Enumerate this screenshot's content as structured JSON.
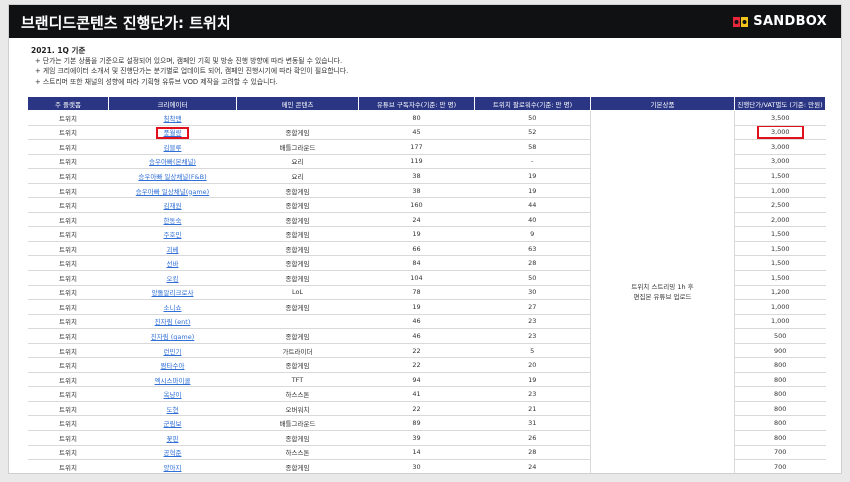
{
  "header": {
    "title": "브랜디드콘텐츠 진행단가: 트위치",
    "brand": "SANDBOX",
    "brand_color": "#e8263c"
  },
  "subtitle": "2021. 1Q 기준",
  "notes": [
    "+ 단가는 기본 상품을 기준으로 설정되어 있으며, 캠페인 기획 및 방송 진행 방향에 따라 변동될 수 있습니다.",
    "+ 게임 크리에이터 소개서 및 진행단가는 분기별로 업데이트 되어, 캠페인 진행시기에 따라 확인이 필요합니다.",
    "+ 스트리머 또한 채널의 성향에 따라 기획형 유튜브 VOD 제작을 고려할 수 있습니다."
  ],
  "table": {
    "headers": [
      "주 플랫폼",
      "크리에이터",
      "메인 콘텐츠",
      "유튜브 구독자수(기준: 만 명)",
      "트위치 팔로워수(기준: 만 명)",
      "기본상품",
      "진행단가/VAT별도 (기준: 만원)"
    ],
    "basic_product_lines": [
      "트위치 스트리밍 1h 후",
      "편집본 유튜브 업로드"
    ],
    "rows": [
      {
        "platform": "트위치",
        "creator": "침착맨",
        "content": "",
        "yt": "80",
        "tw": "50",
        "price": "3,500"
      },
      {
        "platform": "트위치",
        "creator": "풍월량",
        "content": "종합게임",
        "yt": "45",
        "tw": "52",
        "price": "3,000"
      },
      {
        "platform": "트위치",
        "creator": "김블루",
        "content": "배틀그라운드",
        "yt": "177",
        "tw": "58",
        "price": "3,000"
      },
      {
        "platform": "트위치",
        "creator": "승우아빠(본채널)",
        "content": "요리",
        "yt": "119",
        "tw": "-",
        "price": "3,000"
      },
      {
        "platform": "트위치",
        "creator": "승우아빠 일상채널(F&B)",
        "content": "요리",
        "yt": "38",
        "tw": "19",
        "price": "1,500"
      },
      {
        "platform": "트위치",
        "creator": "승우아빠 일상채널(game)",
        "content": "종합게임",
        "yt": "38",
        "tw": "19",
        "price": "1,000"
      },
      {
        "platform": "트위치",
        "creator": "김재원",
        "content": "종합게임",
        "yt": "160",
        "tw": "44",
        "price": "2,500"
      },
      {
        "platform": "트위치",
        "creator": "한동숙",
        "content": "종합게임",
        "yt": "24",
        "tw": "40",
        "price": "2,000"
      },
      {
        "platform": "트위치",
        "creator": "주호민",
        "content": "종합게임",
        "yt": "19",
        "tw": "9",
        "price": "1,500"
      },
      {
        "platform": "트위치",
        "creator": "괴베",
        "content": "종합게임",
        "yt": "66",
        "tw": "63",
        "price": "1,500"
      },
      {
        "platform": "트위치",
        "creator": "선바",
        "content": "종합게임",
        "yt": "84",
        "tw": "28",
        "price": "1,500"
      },
      {
        "platform": "트위치",
        "creator": "오킹",
        "content": "종합게임",
        "yt": "104",
        "tw": "50",
        "price": "1,500"
      },
      {
        "platform": "트위치",
        "creator": "앙돌알리크로사",
        "content": "LoL",
        "yt": "78",
        "tw": "30",
        "price": "1,200"
      },
      {
        "platform": "트위치",
        "creator": "소니쇼",
        "content": "종합게임",
        "yt": "19",
        "tw": "27",
        "price": "1,000"
      },
      {
        "platform": "트위치",
        "creator": "진자림 (ent)",
        "content": "",
        "yt": "46",
        "tw": "23",
        "price": "1,000"
      },
      {
        "platform": "트위치",
        "creator": "진자림 (game)",
        "content": "종합게임",
        "yt": "46",
        "tw": "23",
        "price": "500"
      },
      {
        "platform": "트위치",
        "creator": "런민기",
        "content": "가트라이더",
        "yt": "22",
        "tw": "5",
        "price": "900"
      },
      {
        "platform": "트위치",
        "creator": "짬타수아",
        "content": "종합게임",
        "yt": "22",
        "tw": "20",
        "price": "800"
      },
      {
        "platform": "트위치",
        "creator": "엑시스마이콜",
        "content": "TFT",
        "yt": "94",
        "tw": "19",
        "price": "800"
      },
      {
        "platform": "트위치",
        "creator": "옥냥이",
        "content": "하스스톤",
        "yt": "41",
        "tw": "23",
        "price": "800"
      },
      {
        "platform": "트위치",
        "creator": "도현",
        "content": "오버워치",
        "yt": "22",
        "tw": "21",
        "price": "800"
      },
      {
        "platform": "트위치",
        "creator": "군림보",
        "content": "배틀그라운드",
        "yt": "89",
        "tw": "31",
        "price": "800"
      },
      {
        "platform": "트위치",
        "creator": "꽃핀",
        "content": "종합게임",
        "yt": "39",
        "tw": "26",
        "price": "800"
      },
      {
        "platform": "트위치",
        "creator": "공혁준",
        "content": "하스스톤",
        "yt": "14",
        "tw": "28",
        "price": "700"
      },
      {
        "platform": "트위치",
        "creator": "양아지",
        "content": "종합게임",
        "yt": "30",
        "tw": "24",
        "price": "700"
      }
    ]
  }
}
